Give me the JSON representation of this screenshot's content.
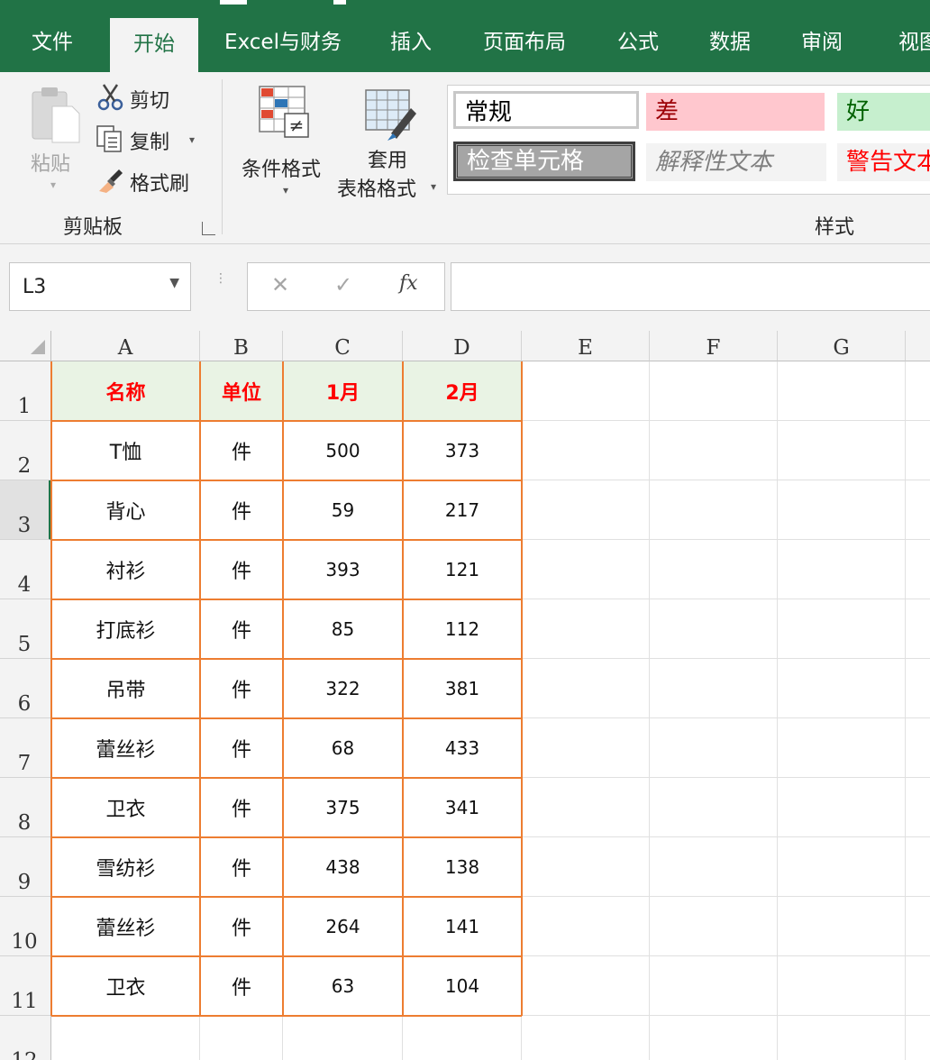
{
  "tabs": [
    {
      "label": "文件",
      "active": false
    },
    {
      "label": "开始",
      "active": true
    },
    {
      "label": "Excel与财务",
      "active": false
    },
    {
      "label": "插入",
      "active": false
    },
    {
      "label": "页面布局",
      "active": false
    },
    {
      "label": "公式",
      "active": false
    },
    {
      "label": "数据",
      "active": false
    },
    {
      "label": "审阅",
      "active": false
    },
    {
      "label": "视图",
      "active": false
    }
  ],
  "ribbon": {
    "clipboard": {
      "paste": "粘贴",
      "cut": "剪切",
      "copy": "复制",
      "format_painter": "格式刷",
      "group_label": "剪贴板"
    },
    "styles": {
      "conditional_format": "条件格式",
      "table_format_line1": "套用",
      "table_format_line2": "表格格式",
      "gallery": [
        {
          "label": "常规",
          "bg": "#ffffff",
          "fg": "#000000"
        },
        {
          "label": "差",
          "bg": "#ffc7ce",
          "fg": "#9c0006"
        },
        {
          "label": "好",
          "bg": "#c6efce",
          "fg": "#006100"
        },
        {
          "label": "检查单元格",
          "bg": "#a5a5a5",
          "fg": "#ffffff"
        },
        {
          "label": "解释性文本",
          "bg": "#f3f3f3",
          "fg": "#7f7f7f"
        },
        {
          "label": "警告文本",
          "bg": "#f3f3f3",
          "fg": "#ff0000"
        }
      ],
      "group_label": "样式"
    }
  },
  "formula_bar": {
    "name_box": "L3",
    "cancel_glyph": "✕",
    "enter_glyph": "✓",
    "fx_glyph": "fx",
    "formula": ""
  },
  "sheet": {
    "columns": [
      "A",
      "B",
      "C",
      "D",
      "E",
      "F",
      "G"
    ],
    "rows": [
      "1",
      "2",
      "3",
      "4",
      "5",
      "6",
      "7",
      "8",
      "9",
      "10",
      "11",
      "12"
    ],
    "selected_row": "3",
    "header": [
      "名称",
      "单位",
      "1月",
      "2月"
    ],
    "data": [
      [
        "T恤",
        "件",
        "500",
        "373"
      ],
      [
        "背心",
        "件",
        "59",
        "217"
      ],
      [
        "衬衫",
        "件",
        "393",
        "121"
      ],
      [
        "打底衫",
        "件",
        "85",
        "112"
      ],
      [
        "吊带",
        "件",
        "322",
        "381"
      ],
      [
        "蕾丝衫",
        "件",
        "68",
        "433"
      ],
      [
        "卫衣",
        "件",
        "375",
        "341"
      ],
      [
        "雪纺衫",
        "件",
        "438",
        "138"
      ],
      [
        "蕾丝衫",
        "件",
        "264",
        "141"
      ],
      [
        "卫衣",
        "件",
        "63",
        "104"
      ]
    ]
  },
  "colors": {
    "brand_green": "#217346",
    "table_border": "#ed7d31",
    "header_fill": "#e9f3e4",
    "header_text": "#ff0000"
  }
}
